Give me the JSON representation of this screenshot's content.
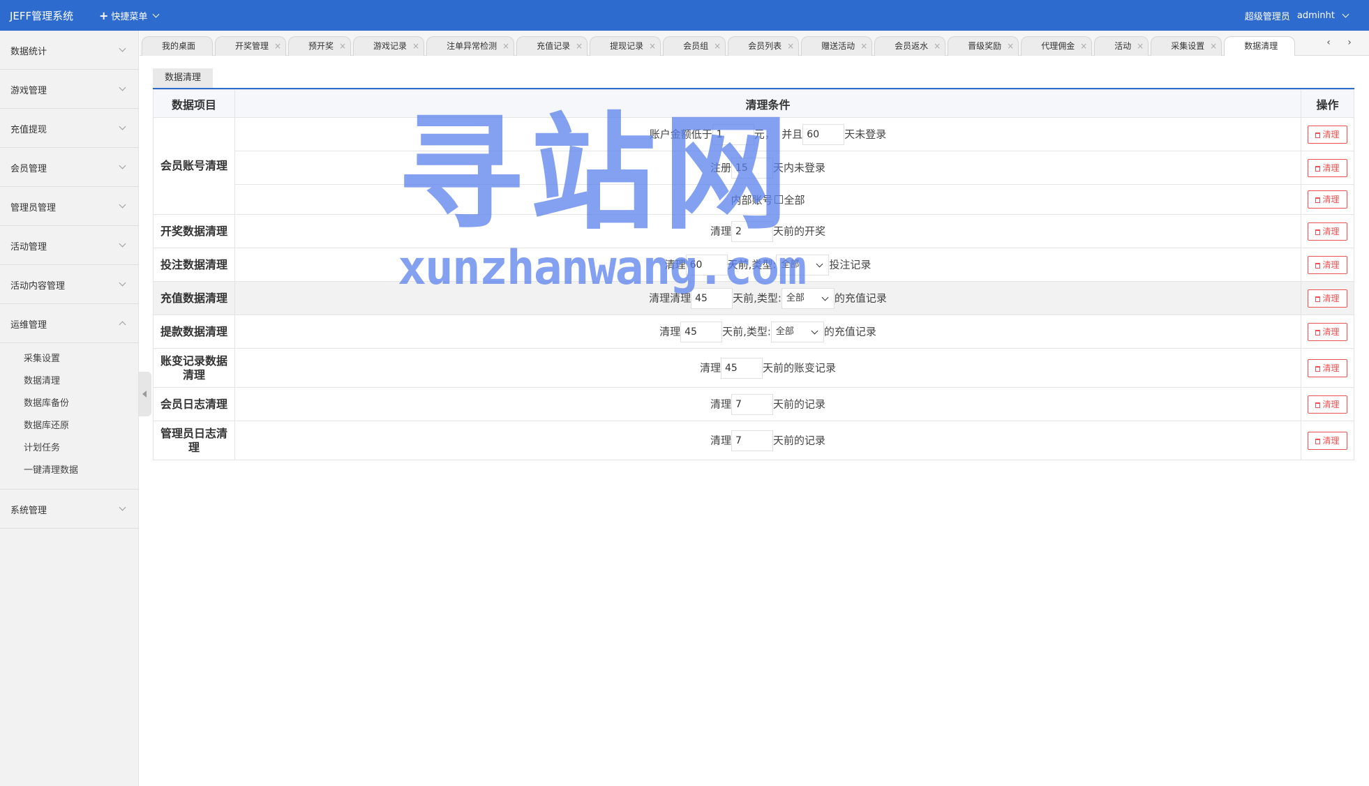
{
  "header": {
    "brand": "JEFF管理系统",
    "quick_menu": "快捷菜单",
    "role": "超级管理员",
    "username": "adminht"
  },
  "sidebar": {
    "items": [
      {
        "label": "数据统计"
      },
      {
        "label": "游戏管理"
      },
      {
        "label": "充值提现"
      },
      {
        "label": "会员管理"
      },
      {
        "label": "管理员管理"
      },
      {
        "label": "活动管理"
      },
      {
        "label": "活动内容管理"
      },
      {
        "label": "运维管理"
      },
      {
        "label": "系统管理"
      }
    ],
    "submenu": [
      "采集设置",
      "数据清理",
      "数据库备份",
      "数据库还原",
      "计划任务",
      "一键清理数据"
    ]
  },
  "tabs": [
    "我的桌面",
    "开奖管理",
    "预开奖",
    "游戏记录",
    "注单异常检测",
    "充值记录",
    "提现记录",
    "会员组",
    "会员列表",
    "赠送活动",
    "会员返水",
    "晋级奖励",
    "代理佣金",
    "活动",
    "采集设置",
    "数据清理"
  ],
  "tab_nav": {
    "prev": "‹",
    "next": "›"
  },
  "content_tab": "数据清理",
  "table": {
    "headers": {
      "item": "数据项目",
      "condition": "清理条件",
      "action": "操作"
    },
    "clean_btn": "清理",
    "select_default": "全部",
    "rows": {
      "member_account": {
        "name": "会员账号清理",
        "r1": {
          "t1": "账户金额低于",
          "v1": "1",
          "t2": "元，",
          "t3": "并且",
          "v2": "60",
          "t4": "天未登录"
        },
        "r2": {
          "t1": "注册",
          "v1": "15",
          "t2": "天内未登录"
        },
        "r3": {
          "t1": "内部账号",
          "t2": "全部"
        }
      },
      "lottery": {
        "name": "开奖数据清理",
        "t1": "清理",
        "v1": "2",
        "t2": "天前的开奖"
      },
      "bet": {
        "name": "投注数据清理",
        "t1": "清理",
        "v1": "60",
        "t2": "天前,类型:",
        "t3": "投注记录"
      },
      "recharge": {
        "name": "充值数据清理",
        "t1": "清理清理",
        "v1": "45",
        "t2": "天前,类型:",
        "t3": "的充值记录"
      },
      "withdraw": {
        "name": "提款数据清理",
        "t1": "清理",
        "v1": "45",
        "t2": "天前,类型:",
        "t3": "的充值记录"
      },
      "account_change": {
        "name": "账变记录数据清理",
        "t1": "清理",
        "v1": "45",
        "t2": "天前的账变记录"
      },
      "member_log": {
        "name": "会员日志清理",
        "t1": "清理",
        "v1": "7",
        "t2": "天前的记录"
      },
      "admin_log": {
        "name": "管理员日志清理",
        "t1": "清理",
        "v1": "7",
        "t2": "天前的记录"
      }
    }
  },
  "watermark": {
    "big": "寻站网",
    "small": "xunzhanwang.com"
  },
  "colors": {
    "primary": "#2e6bcf",
    "danger": "#ec5050"
  }
}
